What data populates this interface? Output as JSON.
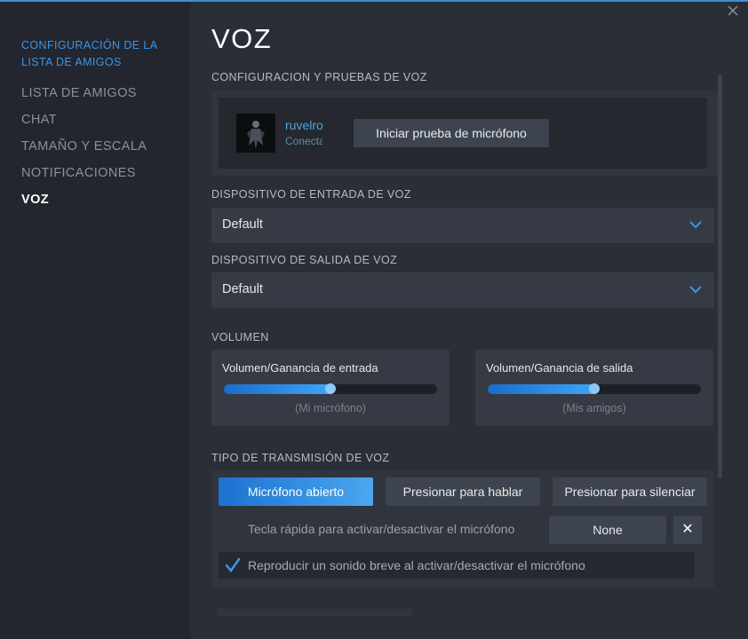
{
  "sidebar": {
    "header": "CONFIGURACIÓN DE LA LISTA DE AMIGOS",
    "items": [
      {
        "label": "LISTA DE AMIGOS"
      },
      {
        "label": "CHAT"
      },
      {
        "label": "TAMAÑO Y ESCALA"
      },
      {
        "label": "NOTIFICACIONES"
      },
      {
        "label": "VOZ"
      }
    ],
    "active_index": 4
  },
  "main": {
    "title": "VOZ",
    "voice_test": {
      "section_title": "CONFIGURACION Y PRUEBAS DE VOZ",
      "user_name": "ruvelro",
      "user_status": "Conectado",
      "mic_test_label": "Iniciar prueba de micrófono"
    },
    "input_device": {
      "section_title": "DISPOSITIVO DE ENTRADA DE VOZ",
      "value": "Default"
    },
    "output_device": {
      "section_title": "DISPOSITIVO DE SALIDA DE VOZ",
      "value": "Default"
    },
    "volume": {
      "section_title": "VOLUMEN",
      "input": {
        "label": "Volumen/Ganancia de entrada",
        "caption": "(Mi micrófono)",
        "level": 0.5
      },
      "output": {
        "label": "Volumen/Ganancia de salida",
        "caption": "(Mis amigos)",
        "level": 0.5
      }
    },
    "transmission": {
      "section_title": "TIPO DE TRANSMISIÓN DE VOZ",
      "options": [
        {
          "label": "Micrófono abierto",
          "selected": true
        },
        {
          "label": "Presionar para hablar",
          "selected": false
        },
        {
          "label": "Presionar para silenciar",
          "selected": false
        }
      ],
      "hotkey_label": "Tecla rápida para activar/desactivar el micrófono",
      "hotkey_value": "None",
      "hotkey_clear": "✕",
      "play_sound_label": "Reproducir un sonido breve al activar/desactivar el micrófono",
      "play_sound_checked": true
    }
  },
  "icons": {
    "close": "close-icon",
    "dropdown": "chevron-down-icon",
    "check": "checkmark-icon"
  },
  "colors": {
    "accent": "#3d95e8",
    "background": "#2a2e37",
    "sidebar": "#23262e"
  }
}
